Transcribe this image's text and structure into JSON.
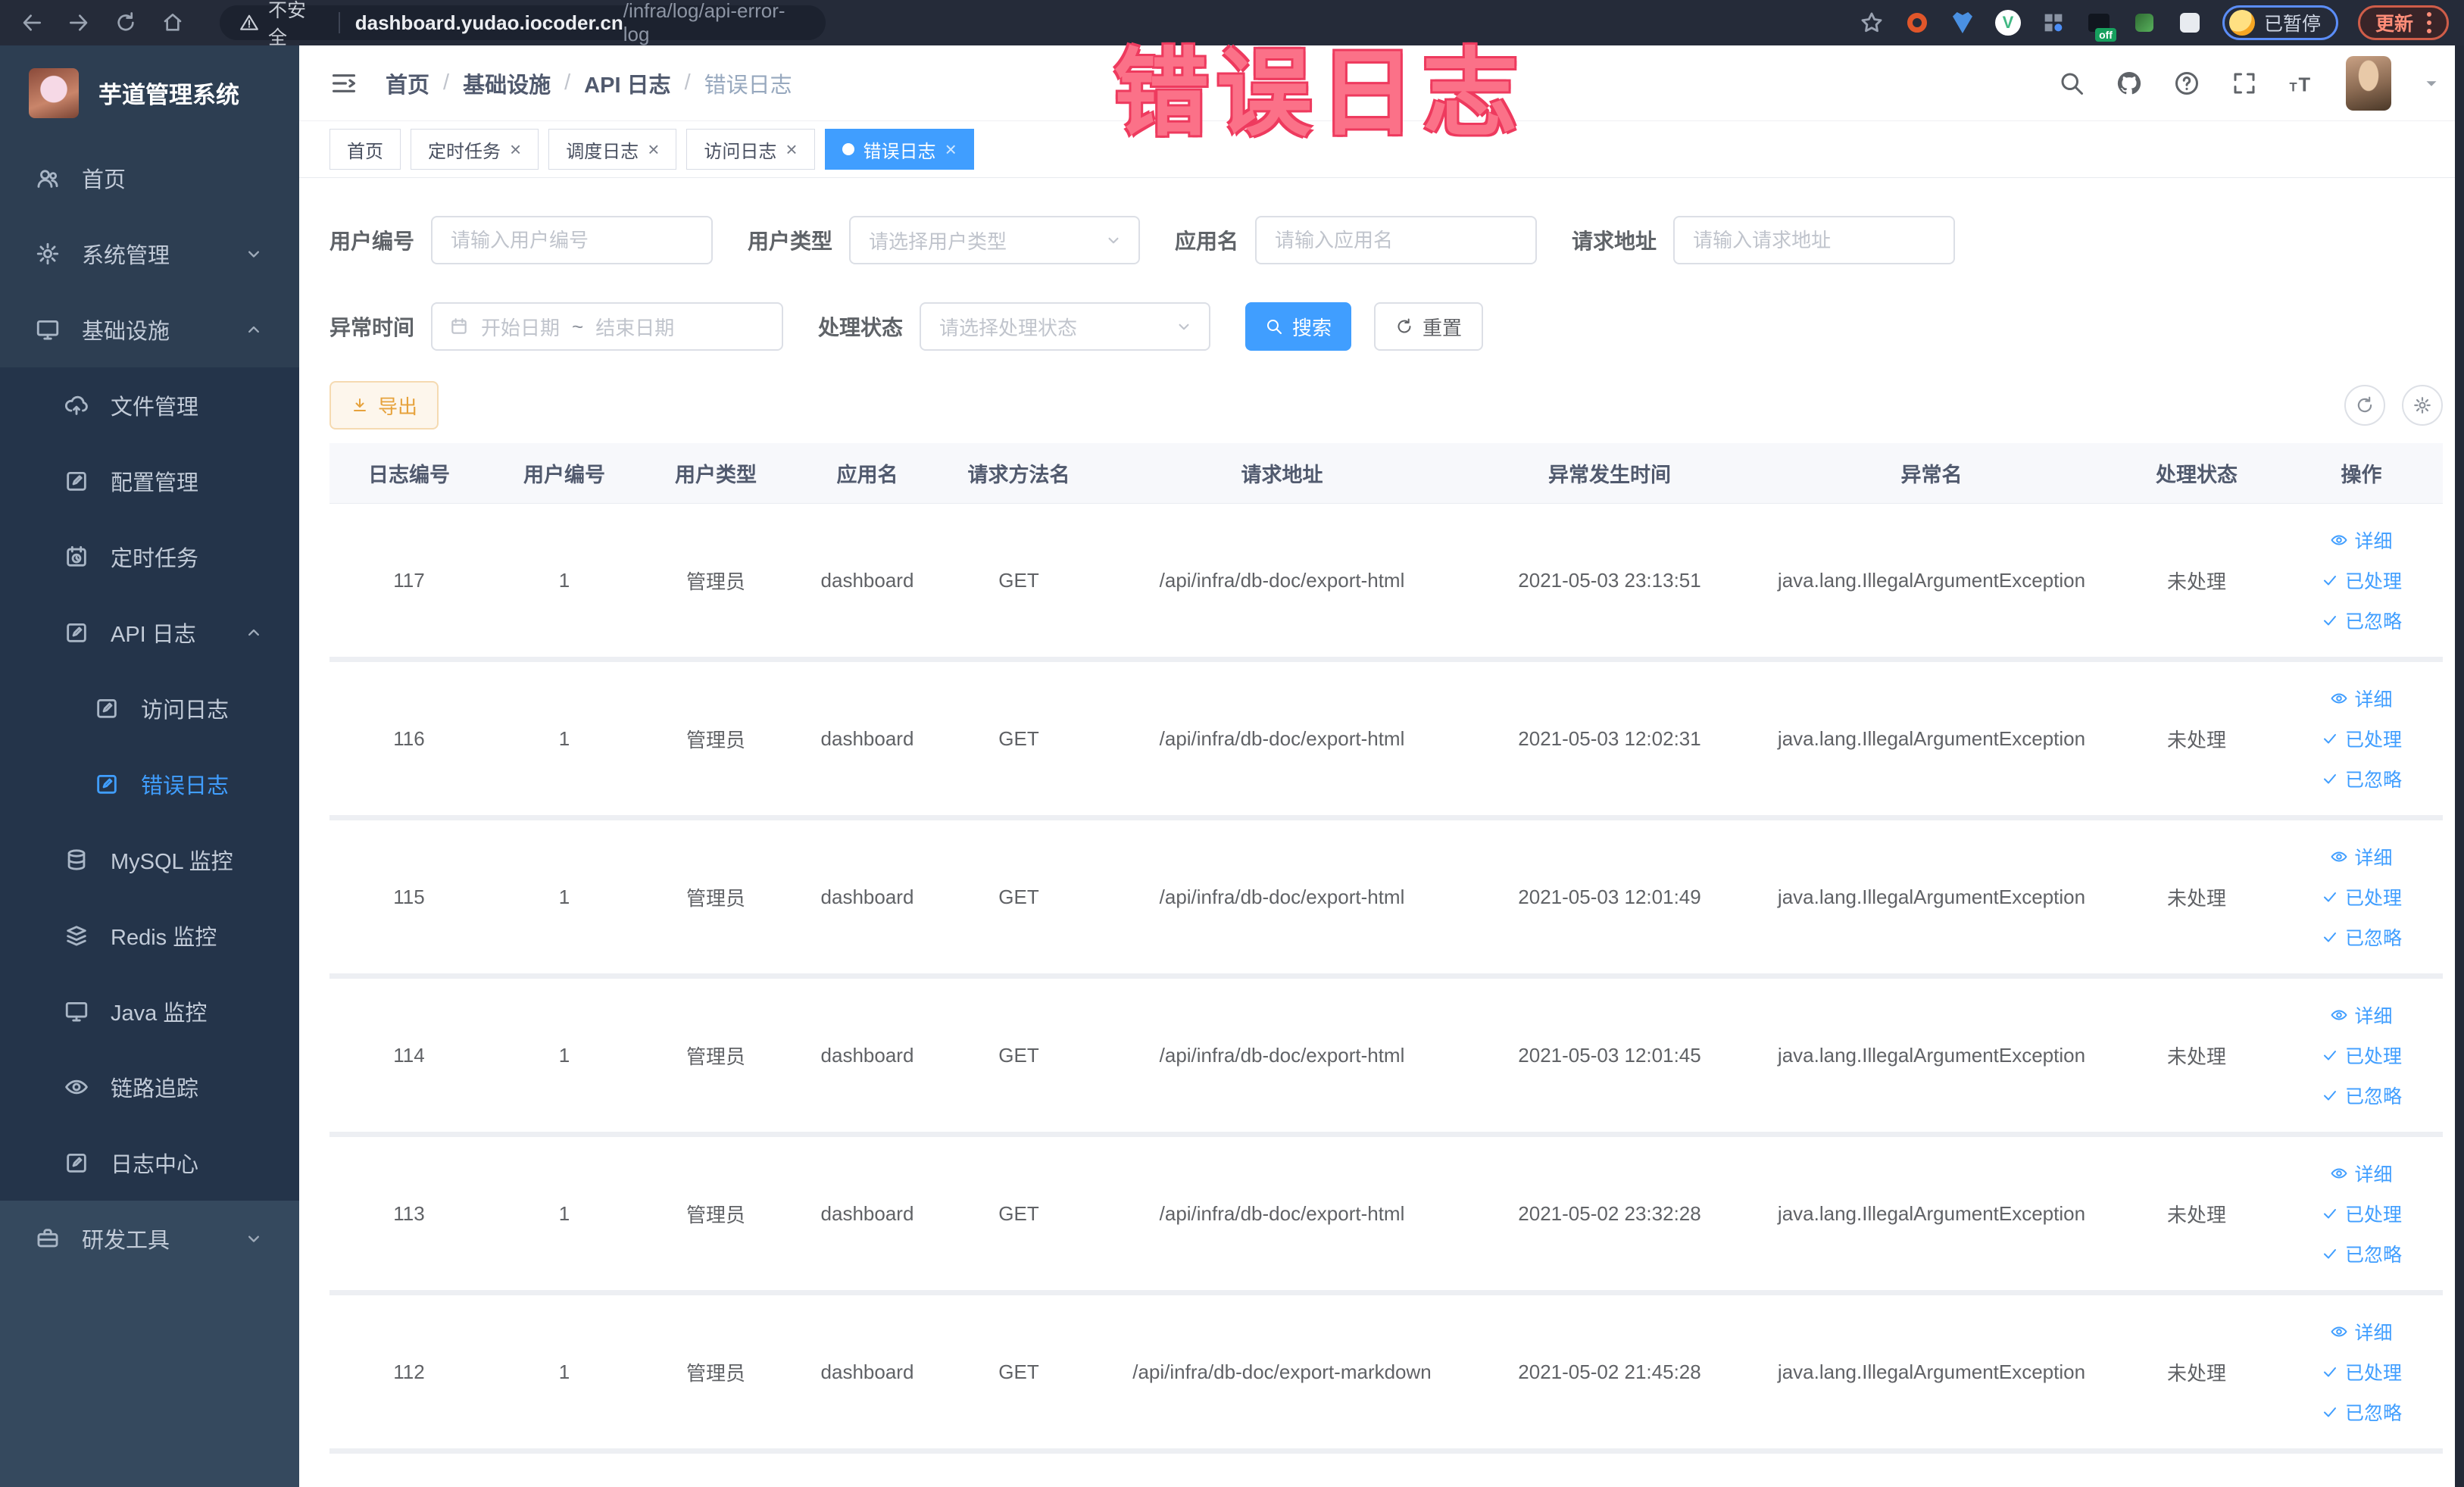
{
  "browser": {
    "security_label": "不安全",
    "url_host": "dashboard.yudao.iocoder.cn",
    "url_path": "/infra/log/api-error-log",
    "profile_label": "已暂停",
    "update_label": "更新",
    "extension_badge": "off"
  },
  "annotation": {
    "text": "错误日志",
    "color": "#fb7188"
  },
  "sidebar": {
    "logo_title": "芋道管理系统",
    "menu": [
      {
        "key": "home",
        "label": "首页",
        "icon": "dashboard-icon",
        "level": 1,
        "section": "top"
      },
      {
        "key": "system-management",
        "label": "系统管理",
        "icon": "gear-icon",
        "level": 1,
        "section": "top",
        "chevron": "down"
      },
      {
        "key": "infrastructure",
        "label": "基础设施",
        "icon": "monitor-icon",
        "level": 1,
        "section": "top",
        "chevron": "up"
      },
      {
        "key": "file-management",
        "label": "文件管理",
        "icon": "cloud-upload-icon",
        "level": 2,
        "section": "sub"
      },
      {
        "key": "config-management",
        "label": "配置管理",
        "icon": "edit-icon",
        "level": 2,
        "section": "sub"
      },
      {
        "key": "scheduled-task",
        "label": "定时任务",
        "icon": "timer-icon",
        "level": 2,
        "section": "sub"
      },
      {
        "key": "api-log",
        "label": "API 日志",
        "icon": "log-icon",
        "level": 2,
        "section": "sub",
        "chevron": "up"
      },
      {
        "key": "access-log",
        "label": "访问日志",
        "icon": "log-icon",
        "level": 3,
        "section": "sub"
      },
      {
        "key": "error-log",
        "label": "错误日志",
        "icon": "log-icon",
        "level": 3,
        "section": "sub",
        "active": true
      },
      {
        "key": "mysql-monitor",
        "label": "MySQL 监控",
        "icon": "database-icon",
        "level": 2,
        "section": "sub"
      },
      {
        "key": "redis-monitor",
        "label": "Redis 监控",
        "icon": "layers-icon",
        "level": 2,
        "section": "sub"
      },
      {
        "key": "java-monitor",
        "label": "Java 监控",
        "icon": "monitor-icon",
        "level": 2,
        "section": "sub"
      },
      {
        "key": "trace",
        "label": "链路追踪",
        "icon": "eye-icon",
        "level": 2,
        "section": "sub"
      },
      {
        "key": "log-center",
        "label": "日志中心",
        "icon": "log-icon",
        "level": 2,
        "section": "sub"
      },
      {
        "key": "dev-tools",
        "label": "研发工具",
        "icon": "briefcase-icon",
        "level": 1,
        "section": "bottom",
        "chevron": "down"
      }
    ]
  },
  "navbar": {
    "breadcrumb": [
      "首页",
      "基础设施",
      "API 日志",
      "错误日志"
    ],
    "right_icons": [
      "search-icon",
      "github-icon",
      "question-icon",
      "fullscreen-icon",
      "font-size-icon"
    ]
  },
  "tabs": [
    {
      "key": "home",
      "label": "首页",
      "closable": false,
      "active": false
    },
    {
      "key": "scheduled-task",
      "label": "定时任务",
      "closable": true,
      "active": false
    },
    {
      "key": "schedule-log",
      "label": "调度日志",
      "closable": true,
      "active": false
    },
    {
      "key": "access-log",
      "label": "访问日志",
      "closable": true,
      "active": false
    },
    {
      "key": "error-log",
      "label": "错误日志",
      "closable": true,
      "active": true
    }
  ],
  "filters": {
    "fields_row1": [
      {
        "key": "user-id",
        "label": "用户编号",
        "type": "input",
        "placeholder": "请输入用户编号"
      },
      {
        "key": "user-type",
        "label": "用户类型",
        "type": "select",
        "placeholder": "请选择用户类型"
      },
      {
        "key": "app-name",
        "label": "应用名",
        "type": "input",
        "placeholder": "请输入应用名"
      },
      {
        "key": "request-url",
        "label": "请求地址",
        "type": "input",
        "placeholder": "请输入请求地址"
      }
    ],
    "time_label": "异常时间",
    "date_start_placeholder": "开始日期",
    "date_separator": "~",
    "date_end_placeholder": "结束日期",
    "status_label": "处理状态",
    "status_placeholder": "请选择处理状态",
    "search_label": "搜索",
    "reset_label": "重置"
  },
  "toolbar": {
    "export_label": "导出"
  },
  "table": {
    "columns": [
      "日志编号",
      "用户编号",
      "用户类型",
      "应用名",
      "请求方法名",
      "请求地址",
      "异常发生时间",
      "异常名",
      "处理状态",
      "操作"
    ],
    "rows": [
      {
        "id": "117",
        "user_id": "1",
        "user_type": "管理员",
        "app": "dashboard",
        "method": "GET",
        "url": "/api/infra/db-doc/export-html",
        "time": "2021-05-03 23:13:51",
        "exception": "java.lang.IllegalArgumentException",
        "status": "未处理"
      },
      {
        "id": "116",
        "user_id": "1",
        "user_type": "管理员",
        "app": "dashboard",
        "method": "GET",
        "url": "/api/infra/db-doc/export-html",
        "time": "2021-05-03 12:02:31",
        "exception": "java.lang.IllegalArgumentException",
        "status": "未处理"
      },
      {
        "id": "115",
        "user_id": "1",
        "user_type": "管理员",
        "app": "dashboard",
        "method": "GET",
        "url": "/api/infra/db-doc/export-html",
        "time": "2021-05-03 12:01:49",
        "exception": "java.lang.IllegalArgumentException",
        "status": "未处理"
      },
      {
        "id": "114",
        "user_id": "1",
        "user_type": "管理员",
        "app": "dashboard",
        "method": "GET",
        "url": "/api/infra/db-doc/export-html",
        "time": "2021-05-03 12:01:45",
        "exception": "java.lang.IllegalArgumentException",
        "status": "未处理"
      },
      {
        "id": "113",
        "user_id": "1",
        "user_type": "管理员",
        "app": "dashboard",
        "method": "GET",
        "url": "/api/infra/db-doc/export-html",
        "time": "2021-05-02 23:32:28",
        "exception": "java.lang.IllegalArgumentException",
        "status": "未处理"
      },
      {
        "id": "112",
        "user_id": "1",
        "user_type": "管理员",
        "app": "dashboard",
        "method": "GET",
        "url": "/api/infra/db-doc/export-markdown",
        "time": "2021-05-02 21:45:28",
        "exception": "java.lang.IllegalArgumentException",
        "status": "未处理"
      }
    ],
    "actions": [
      {
        "key": "detail",
        "label": "详细",
        "icon": "eye-icon"
      },
      {
        "key": "processed",
        "label": "已处理",
        "icon": "check-icon"
      },
      {
        "key": "ignored",
        "label": "已忽略",
        "icon": "check-icon"
      }
    ]
  },
  "colors": {
    "accent": "#409eff",
    "tab_active_bg": "#409eff",
    "sidebar_active": "#409eff",
    "export_text": "#e6a23c",
    "annotation": "#fb7188"
  }
}
